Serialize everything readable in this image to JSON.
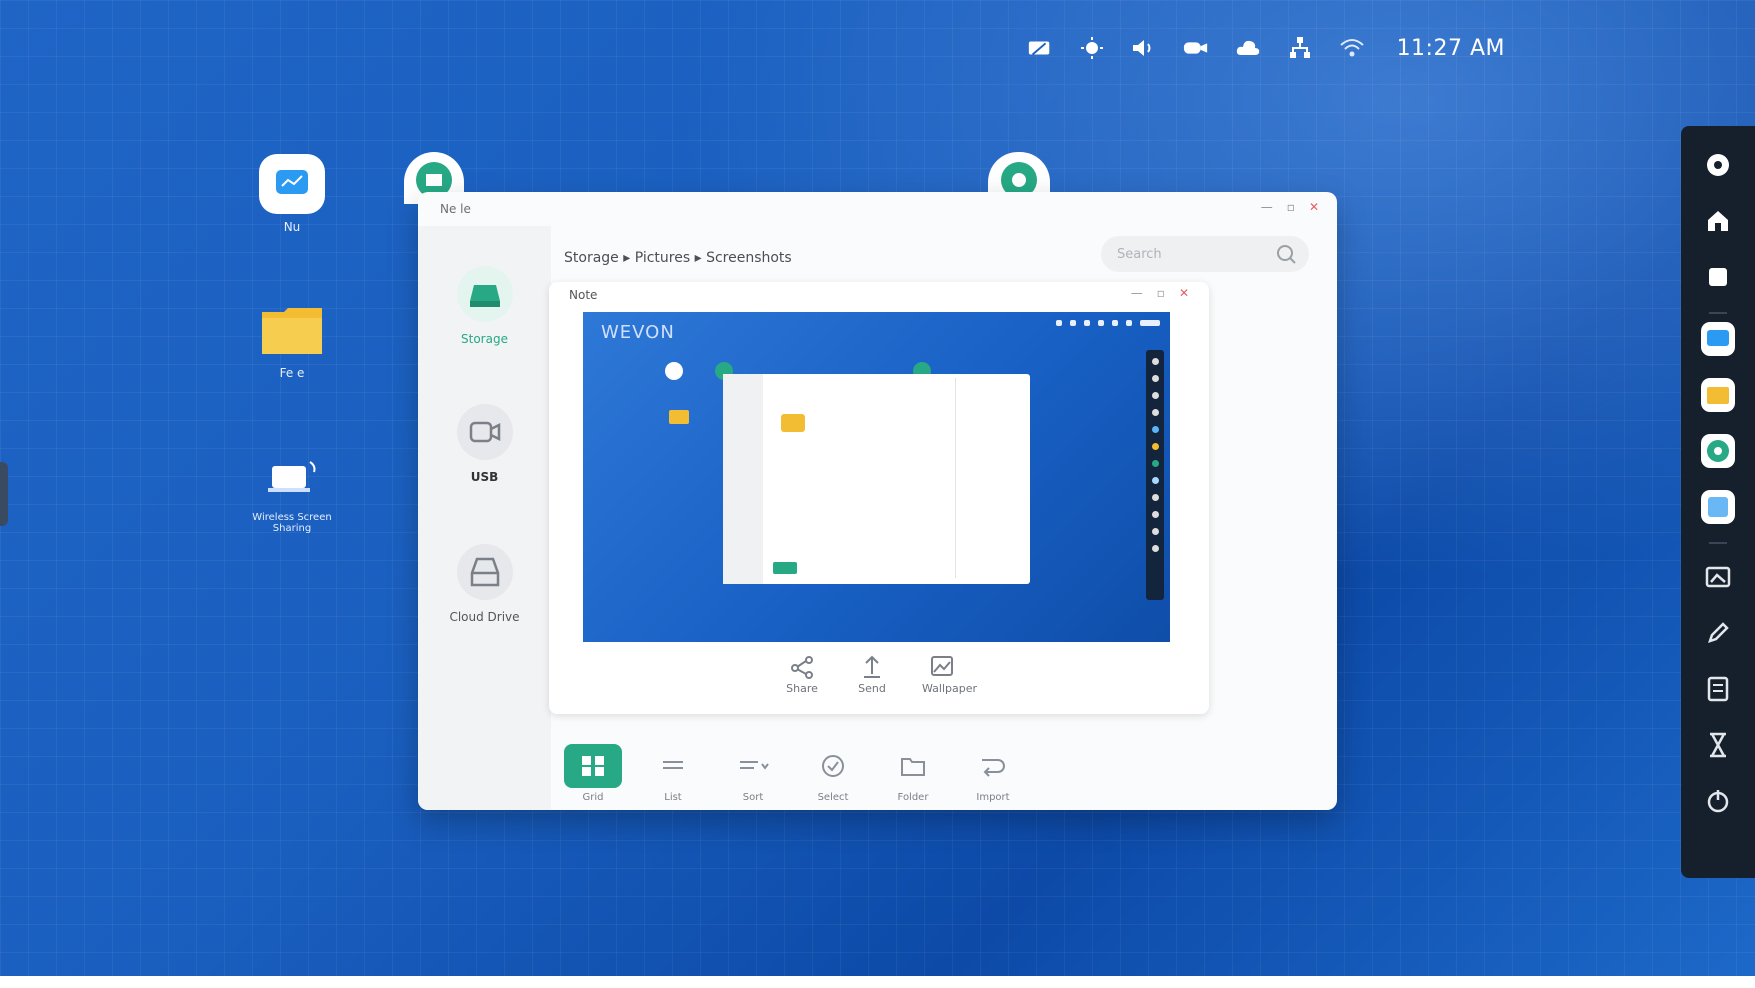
{
  "status_bar": {
    "time": "11:27 AM",
    "icons": [
      "screen-share-icon",
      "brightness-icon",
      "volume-icon",
      "camera-icon",
      "cloud-icon",
      "network-icon",
      "wifi-icon"
    ]
  },
  "desktop": {
    "icons": [
      {
        "name": "whiteboard-app",
        "label": "Nu"
      },
      {
        "name": "folder-app",
        "label": "Fe e"
      },
      {
        "name": "wireless-screen-app",
        "label": "Wireless Screen Sharing"
      }
    ]
  },
  "window": {
    "title": "Ne le",
    "breadcrumb": "Storage  ▸  Pictures  ▸  Screenshots",
    "search_placeholder": "Search",
    "sidebar": [
      {
        "label": "Storage"
      },
      {
        "label": "USB"
      },
      {
        "label": "Cloud Drive"
      }
    ],
    "preview": {
      "title": "Note",
      "screenshot_logo": "WEVON",
      "actions": [
        {
          "label": "Share",
          "icon": "share-icon"
        },
        {
          "label": "Send",
          "icon": "send-icon"
        },
        {
          "label": "Wallpaper",
          "icon": "wallpaper-icon"
        }
      ]
    },
    "bottom_bar": [
      {
        "label": "Grid",
        "icon": "grid-icon"
      },
      {
        "label": "List",
        "icon": "list-icon"
      },
      {
        "label": "Sort",
        "icon": "sort-icon"
      },
      {
        "label": "Select",
        "icon": "select-icon"
      },
      {
        "label": "Folder",
        "icon": "folder-icon"
      },
      {
        "label": "Import",
        "icon": "import-icon"
      }
    ]
  },
  "dock": {
    "items": [
      "settings-icon",
      "home-icon",
      "recent-icon",
      "whiteboard-icon",
      "folder-icon",
      "browser-icon",
      "apps-icon",
      "screenshot-icon",
      "annotate-icon",
      "notes-icon",
      "timer-icon",
      "power-icon"
    ]
  },
  "colors": {
    "accent": "#27a985",
    "desktop_blue": "#1a5fbf",
    "dock_bg": "#16202d",
    "folder_yellow": "#f3bd33"
  }
}
